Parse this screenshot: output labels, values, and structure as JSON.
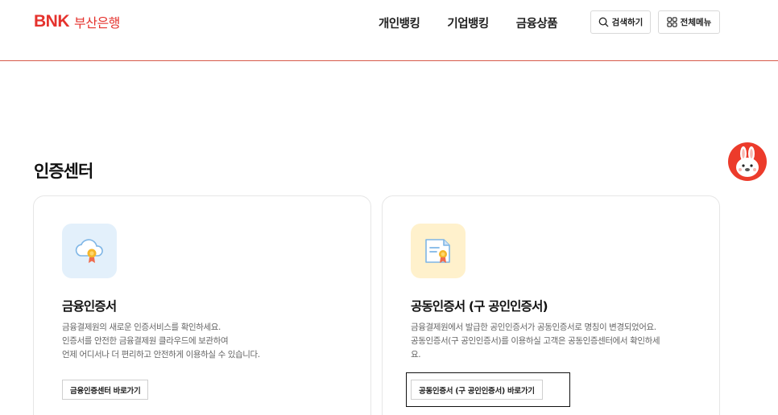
{
  "brand": {
    "bnk": "BNK",
    "name": "부산은행",
    "color": "#e5322d"
  },
  "nav": {
    "items": [
      "개인뱅킹",
      "기업뱅킹",
      "금융상품"
    ]
  },
  "header_buttons": {
    "search": "검색하기",
    "menu": "전체메뉴"
  },
  "page": {
    "title": "인증센터"
  },
  "cards": [
    {
      "title": "금융인증서",
      "desc": [
        "금융결제원의 새로운 인증서비스를 확인하세요.",
        "인증서를 안전한 금융결제원 클라우드에 보관하여",
        "언제 어디서나 더 편리하고 안전하게 이용하실 수 있습니다."
      ],
      "button": "금융인증센터 바로가기",
      "icon": "cloud-certificate-icon"
    },
    {
      "title": "공동인증서 (구 공인인증서)",
      "desc": [
        "금융결제원에서 발급한 공인인증서가 공동인증서로 명칭이 변경되었어요.",
        "공동인증서(구 공인인증서)를 이용하실 고객은 공동인증센터에서 확인하세",
        "요."
      ],
      "button": "공동인증서 (구 공인인증서) 바로가기",
      "icon": "document-certificate-icon"
    }
  ],
  "colors": {
    "accent": "#e5322d",
    "header_line": "#d65a4a",
    "blue_tile": "#e3f0fb",
    "yellow_tile": "#fff1cc"
  }
}
